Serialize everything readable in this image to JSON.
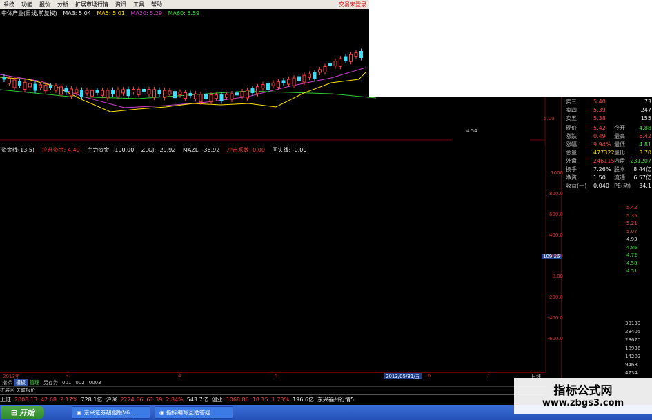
{
  "menu": {
    "items": [
      "系统",
      "功能",
      "报价",
      "分析",
      "扩展市场行情",
      "资讯",
      "工具",
      "帮助"
    ],
    "login": "交易未登录",
    "extra": "中动"
  },
  "kline_info": {
    "title": "中体产业(日线,前复权)",
    "ma3": "MA3: 5.04",
    "ma5": "MA5: 5.01",
    "ma20": "MA20: 5.29",
    "ma60": "MA60: 5.59"
  },
  "mini": {
    "low_label": "4.54",
    "price_label": "5.00"
  },
  "quote": {
    "rows": [
      {
        "l": "卖三",
        "v1": "5.40",
        "l2": "",
        "v2": "73"
      },
      {
        "l": "卖四",
        "v1": "5.39",
        "l2": "",
        "v2": "247"
      },
      {
        "l": "卖五",
        "v1": "5.38",
        "l2": "",
        "v2": "155"
      },
      {
        "l": "现价",
        "v1": "5.42",
        "l2": "今开",
        "v2": "4.88"
      },
      {
        "l": "涨跌",
        "v1": "0.49",
        "l2": "最高",
        "v2": "5.42"
      },
      {
        "l": "涨幅",
        "v1": "9.94%",
        "l2": "最低",
        "v2": "4.81"
      },
      {
        "l": "总量",
        "v1": "477322",
        "l2": "量比",
        "v2": "3.70"
      },
      {
        "l": "外盘",
        "v1": "246115",
        "l2": "内盘",
        "v2": "231207"
      },
      {
        "l": "换手",
        "v1": "7.26%",
        "l2": "股本",
        "v2": "8.44亿"
      },
      {
        "l": "净资",
        "v1": "1.50",
        "l2": "流通",
        "v2": "6.57亿"
      },
      {
        "l": "收益(一)",
        "v1": "0.040",
        "l2": "PE(动)",
        "v2": "34.1"
      }
    ],
    "price_axis": [
      "5.42",
      "5.35",
      "5.21",
      "5.07",
      "4.93",
      "4.86",
      "4.72",
      "4.58",
      "4.51"
    ],
    "vol_axis": [
      "33139",
      "28405",
      "23670",
      "18936",
      "14202",
      "9468",
      "4734"
    ]
  },
  "indicator": {
    "name": "资金线(13,5)",
    "items": [
      "拉升资金: 4.40",
      "主力资金: -100.00",
      "ZLGJ: -29.92",
      "MAZL: -36.92",
      "冲击系数: 0.00",
      "回头线: -0.00"
    ],
    "yaxis": [
      "1000",
      "800.0",
      "600.0",
      "400.0",
      "200.0",
      "0.00",
      "-200.0",
      "-400.0",
      "-600.0"
    ],
    "cursor_value": "109.26"
  },
  "date_axis": {
    "year": "2013年",
    "marks": [
      "3",
      "4",
      "5",
      "6",
      "7"
    ],
    "cursor_date": "2013/05/31/五",
    "right": "日线"
  },
  "tabs": [
    "指标",
    "模板",
    "管理",
    "另存为",
    "001",
    "002",
    "0003"
  ],
  "extra": "扩展区  关联报价",
  "index_bar": [
    {
      "t": "上证",
      "c": "white"
    },
    {
      "t": "2008.13",
      "c": "red"
    },
    {
      "t": "42.68",
      "c": "red"
    },
    {
      "t": "2.17%",
      "c": "red"
    },
    {
      "t": "728.1亿",
      "c": "white"
    },
    {
      "t": "沪深",
      "c": "white"
    },
    {
      "t": "2224.66",
      "c": "red"
    },
    {
      "t": "61.39",
      "c": "red"
    },
    {
      "t": "2.84%",
      "c": "red"
    },
    {
      "t": "543.7亿",
      "c": "white"
    },
    {
      "t": "创业",
      "c": "white"
    },
    {
      "t": "1068.86",
      "c": "red"
    },
    {
      "t": "18.15",
      "c": "red"
    },
    {
      "t": "1.73%",
      "c": "red"
    },
    {
      "t": "196.6亿",
      "c": "white"
    },
    {
      "t": "东兴福州行情5",
      "c": "white"
    }
  ],
  "taskbar": {
    "start": "开始",
    "task1": "东兴证券超强版V6...",
    "task2": "指标编写互助答疑..."
  },
  "watermark": {
    "title": "指标公式网",
    "url": "www.zbgs3.com"
  },
  "colors": {
    "up": "#ff4040",
    "down": "#3ce0ff",
    "ma3": "#ffffff",
    "ma5": "#ffe000",
    "ma20": "#cc44cc",
    "ma60": "#33cc33"
  }
}
